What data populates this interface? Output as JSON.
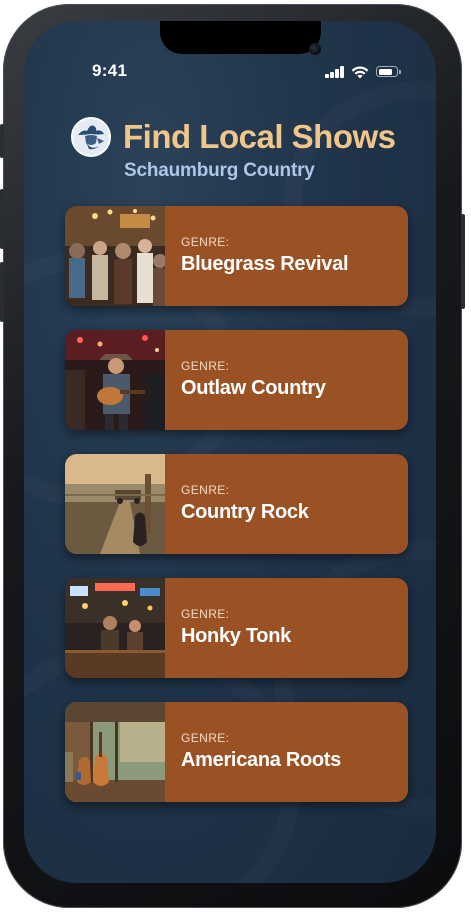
{
  "status_bar": {
    "time": "9:41",
    "battery_level": 0.85
  },
  "header": {
    "title": "Find Local Shows",
    "subtitle": "Schaumburg Country",
    "logo_icon": "cowboy-logo-icon"
  },
  "genre_prefix": "GENRE:",
  "shows": [
    {
      "genre": "Bluegrass Revival",
      "image": "crowd-dancing-photo"
    },
    {
      "genre": "Outlaw Country",
      "image": "guitarist-on-stage-photo"
    },
    {
      "genre": "Country Rock",
      "image": "dirt-road-guitar-photo"
    },
    {
      "genre": "Honky Tonk",
      "image": "honky-tonk-bar-photo"
    },
    {
      "genre": "Americana Roots",
      "image": "porch-guitar-photo"
    }
  ],
  "colors": {
    "background": "#20344a",
    "card": "#9a5225",
    "title": "#f1c68a",
    "subtitle": "#aec6e8"
  }
}
